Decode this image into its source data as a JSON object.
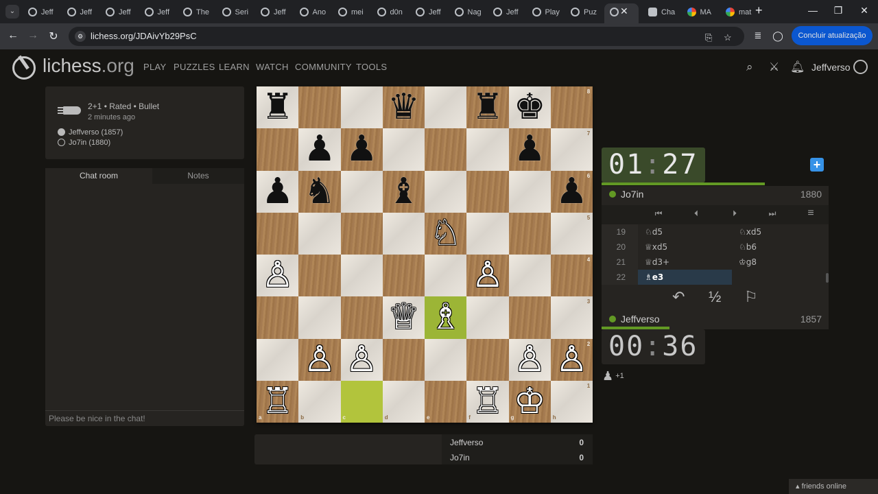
{
  "browser": {
    "tabs": [
      {
        "label": "Jeff",
        "fav": "lichess"
      },
      {
        "label": "Jeff",
        "fav": "lichess"
      },
      {
        "label": "Jeff",
        "fav": "lichess"
      },
      {
        "label": "Jeff",
        "fav": "lichess"
      },
      {
        "label": "The",
        "fav": "lichess"
      },
      {
        "label": "Seri",
        "fav": "lichess"
      },
      {
        "label": "Jeff",
        "fav": "lichess"
      },
      {
        "label": "Ano",
        "fav": "lichess"
      },
      {
        "label": "mei",
        "fav": "lichess"
      },
      {
        "label": "d0n",
        "fav": "lichess"
      },
      {
        "label": "Jeff",
        "fav": "lichess"
      },
      {
        "label": "Nag",
        "fav": "lichess"
      },
      {
        "label": "Jeff",
        "fav": "lichess"
      },
      {
        "label": "Play",
        "fav": "lichess"
      },
      {
        "label": "Puz",
        "fav": "lichess"
      },
      {
        "label": "",
        "fav": "lichess",
        "active": true
      },
      {
        "label": "Cha",
        "fav": "chatgpt"
      },
      {
        "label": "MA",
        "fav": "google"
      },
      {
        "label": "mat",
        "fav": "google"
      }
    ],
    "close_tab": "✕",
    "new_tab": "+",
    "url": "lichess.org/JDAivYb29PsC",
    "update_label": "Concluir atualização",
    "window": {
      "minimize": "—",
      "maximize": "❐",
      "close": "✕"
    }
  },
  "header": {
    "logo_main": "lichess",
    "logo_tld": ".org",
    "nav": [
      "PLAY",
      "PUZZLES",
      "LEARN",
      "WATCH",
      "COMMUNITY",
      "TOOLS"
    ],
    "username": "Jeffverso"
  },
  "game_info": {
    "line1": "2+1 • Rated • Bullet",
    "line2": "2 minutes ago",
    "white": "Jeffverso (1857)",
    "black": "Jo7in (1880)"
  },
  "chat": {
    "tabs": [
      "Chat room",
      "Notes"
    ],
    "placeholder": "Please be nice in the chat!"
  },
  "board": {
    "files": [
      "a",
      "b",
      "c",
      "d",
      "e",
      "f",
      "g",
      "h"
    ],
    "ranks": [
      "8",
      "7",
      "6",
      "5",
      "4",
      "3",
      "2",
      "1"
    ],
    "pieces": [
      {
        "sq": "a8",
        "p": "♜",
        "c": "b"
      },
      {
        "sq": "d8",
        "p": "♛",
        "c": "b"
      },
      {
        "sq": "f8",
        "p": "♜",
        "c": "b"
      },
      {
        "sq": "g8",
        "p": "♚",
        "c": "b"
      },
      {
        "sq": "b7",
        "p": "♟",
        "c": "b"
      },
      {
        "sq": "c7",
        "p": "♟",
        "c": "b"
      },
      {
        "sq": "g7",
        "p": "♟",
        "c": "b"
      },
      {
        "sq": "a6",
        "p": "♟",
        "c": "b"
      },
      {
        "sq": "b6",
        "p": "♞",
        "c": "b"
      },
      {
        "sq": "d6",
        "p": "♝",
        "c": "b"
      },
      {
        "sq": "h6",
        "p": "♟",
        "c": "b"
      },
      {
        "sq": "e5",
        "p": "♘",
        "c": "w"
      },
      {
        "sq": "a4",
        "p": "♙",
        "c": "w"
      },
      {
        "sq": "f4",
        "p": "♙",
        "c": "w"
      },
      {
        "sq": "d3",
        "p": "♕",
        "c": "w"
      },
      {
        "sq": "e3",
        "p": "♗",
        "c": "w"
      },
      {
        "sq": "b2",
        "p": "♙",
        "c": "w"
      },
      {
        "sq": "c2",
        "p": "♙",
        "c": "w"
      },
      {
        "sq": "g2",
        "p": "♙",
        "c": "w"
      },
      {
        "sq": "h2",
        "p": "♙",
        "c": "w"
      },
      {
        "sq": "a1",
        "p": "♖",
        "c": "w"
      },
      {
        "sq": "f1",
        "p": "♖",
        "c": "w"
      },
      {
        "sq": "g1",
        "p": "♔",
        "c": "w"
      }
    ],
    "last_move": [
      "c1",
      "e3"
    ]
  },
  "opponent": {
    "name": "Jo7in",
    "rating": "1880",
    "clock_min": "01",
    "clock_sec": "27",
    "time_fraction": 0.72
  },
  "player": {
    "name": "Jeffverso",
    "rating": "1857",
    "clock_min": "00",
    "clock_sec": "36",
    "time_fraction": 0.3
  },
  "clock_sep": ":",
  "moves": [
    {
      "n": "19",
      "w": "♘d5",
      "b": "♘xd5"
    },
    {
      "n": "20",
      "w": "♕xd5",
      "b": "♘b6"
    },
    {
      "n": "21",
      "w": "♕d3+",
      "b": "♔g8"
    },
    {
      "n": "22",
      "w": "♗e3",
      "b": "",
      "current": "w"
    }
  ],
  "controls": {
    "first": "⏮",
    "prev": "⏴",
    "next": "⏵",
    "last": "⏭",
    "menu": "≡"
  },
  "actions": {
    "takeback": "↶",
    "draw": "½",
    "resign": "⚐"
  },
  "material": "+1",
  "scoreboard": [
    {
      "name": "Jeffverso",
      "score": "0"
    },
    {
      "name": "Jo7in",
      "score": "0"
    }
  ],
  "friends": "friends online",
  "colors": {
    "accent": "#629924",
    "highlight": "#9cb536",
    "blue": "#3692e7"
  }
}
